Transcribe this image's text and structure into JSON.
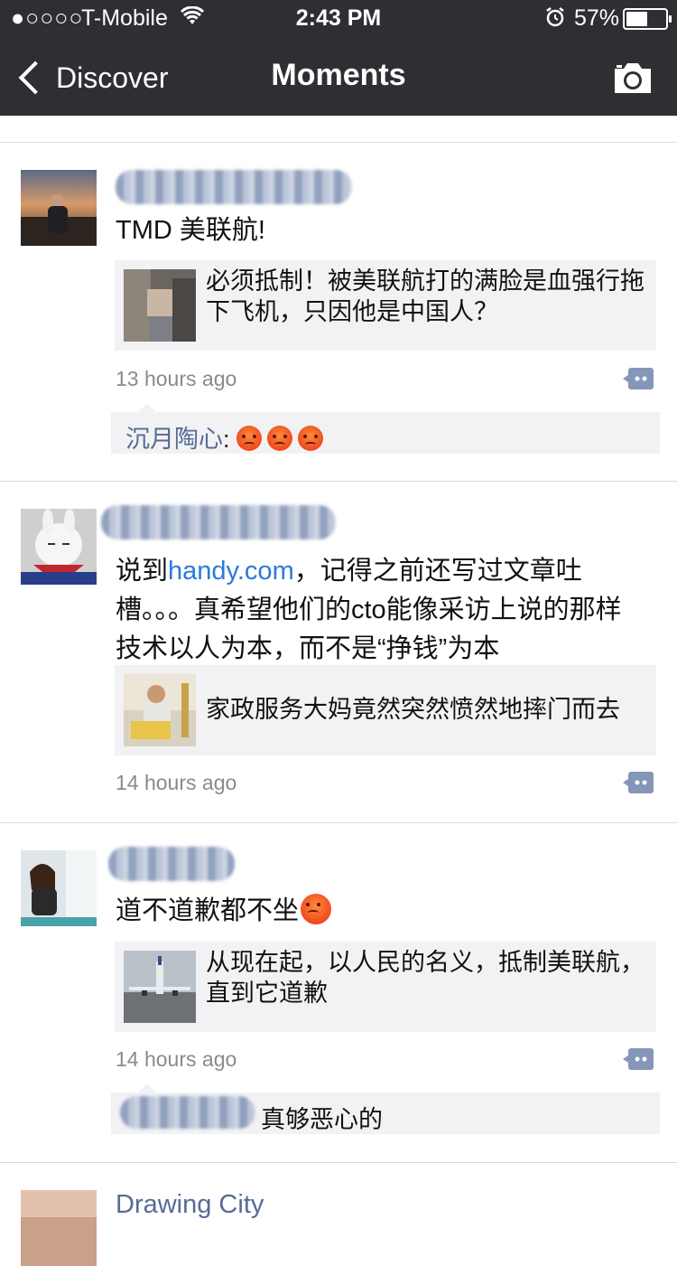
{
  "status_bar": {
    "signal": "●○○○○",
    "carrier": "T-Mobile",
    "time": "2:43 PM",
    "battery_percent": "57%",
    "battery_level": 0.57,
    "icons": [
      "wifi-icon",
      "alarm-icon",
      "battery-icon"
    ]
  },
  "nav": {
    "back_label": "Discover",
    "title": "Moments",
    "camera_icon": "camera-icon"
  },
  "posts": [
    {
      "text": "TMD 美联航!",
      "link_card": {
        "title": "必须抵制！被美联航打的满脸是血强行拖下飞机，只因他是中国人？"
      },
      "time": "13 hours ago",
      "comments": [
        {
          "author": "沉月陶心",
          "separator": ":",
          "emoji": [
            "angry-emoji",
            "angry-emoji",
            "angry-emoji"
          ]
        }
      ]
    },
    {
      "text_pre": "说到",
      "text_link": "handy.com",
      "text_post": "，记得之前还写过文章吐槽。。。真希望他们的cto能像采访上说的那样技术以人为本，而不是“挣钱”为本",
      "link_card": {
        "title": "家政服务大妈竟然突然愤然地摔门而去"
      },
      "time": "14 hours ago"
    },
    {
      "text": "道不道歉都不坐",
      "link_card": {
        "title": "从现在起，以人民的名义，抵制美联航，直到它道歉"
      },
      "time": "14 hours ago",
      "comments": [
        {
          "text": "真够恶心的"
        }
      ]
    },
    {
      "name": "Drawing City"
    }
  ],
  "colors": {
    "nav_bg": "#2f2f33",
    "link": "#2a7ad8",
    "name": "#576b95",
    "card_bg": "#f2f2f4"
  }
}
